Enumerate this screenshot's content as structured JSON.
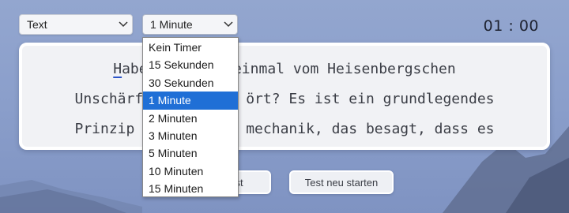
{
  "mode_select": {
    "value": "Text",
    "icon": "chevron-down-icon"
  },
  "timer_select": {
    "value": "1 Minute",
    "icon": "chevron-down-icon",
    "options": [
      "Kein Timer",
      "15 Sekunden",
      "30 Sekunden",
      "1 Minute",
      "2 Minuten",
      "3 Minuten",
      "5 Minuten",
      "10 Minuten",
      "15 Minuten"
    ],
    "selected_index": 3
  },
  "timer_display": "01 : 00",
  "text_card": {
    "line1_cursor_char": "H",
    "line1_rest": "aben S       einmal vom Heisenbergschen",
    "line2": "Unschärfep          ört? Es ist ein grundlegendes",
    "line3": "Prinzip de          mechanik, das besagt, dass es"
  },
  "buttons": {
    "submit_visible_label": "st",
    "restart_label": "Test neu starten"
  },
  "colors": {
    "background": "#8b9fcb",
    "selected_option": "#1f6fd6",
    "cursor_underline": "#2b54c8"
  }
}
